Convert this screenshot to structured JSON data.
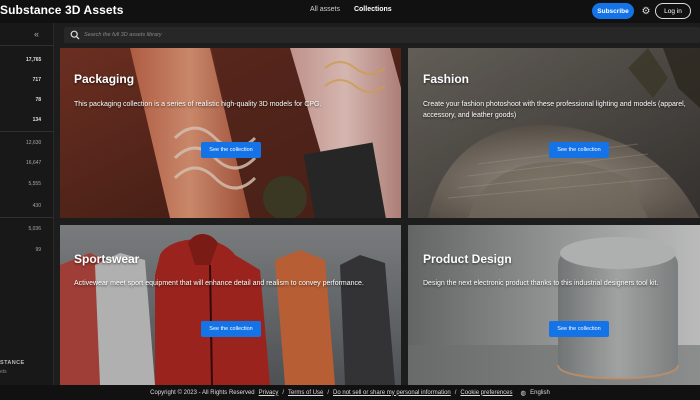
{
  "header": {
    "brand": "Substance 3D Assets",
    "nav": [
      "All assets",
      "Collections"
    ],
    "subscribe_label": "Subscribe",
    "login_label": "Log in",
    "gear_icon": "gear-icon"
  },
  "sidebar": {
    "collapse_glyph": "«",
    "counts": [
      "17,765",
      "717",
      "78",
      "134",
      "12,630",
      "16,647",
      "5,555",
      "430",
      "5,036",
      "99"
    ],
    "logo_text": "STANCE",
    "logo_sub": "ets"
  },
  "search": {
    "placeholder": "Search the full 3D assets library"
  },
  "collections": [
    {
      "title": "Packaging",
      "description": "This packaging collection is a series of realistic high-quality 3D models for CPG.",
      "button": "See the collection"
    },
    {
      "title": "Fashion",
      "description": "Create your fashion photoshoot with these professional lighting and models (apparel, accessory, and leather goods)",
      "button": "See the collection"
    },
    {
      "title": "Sportswear",
      "description": "Activewear meet sport equipment that will enhance detail and realism to convey performance.",
      "button": "See the collection"
    },
    {
      "title": "Product Design",
      "description": "Design the next electronic product thanks to this industrial designers tool kit.",
      "button": "See the collection"
    }
  ],
  "footer": {
    "copyright": "Copyright © 2023 - All Rights Reserved",
    "links": [
      "Privacy",
      "Terms of Use",
      "Do not sell or share my personal information",
      "Cookie preferences"
    ],
    "separator": "/",
    "language": "English"
  },
  "colors": {
    "accent": "#1473e6",
    "background": "#1d1d1d",
    "topbar": "#111111"
  }
}
